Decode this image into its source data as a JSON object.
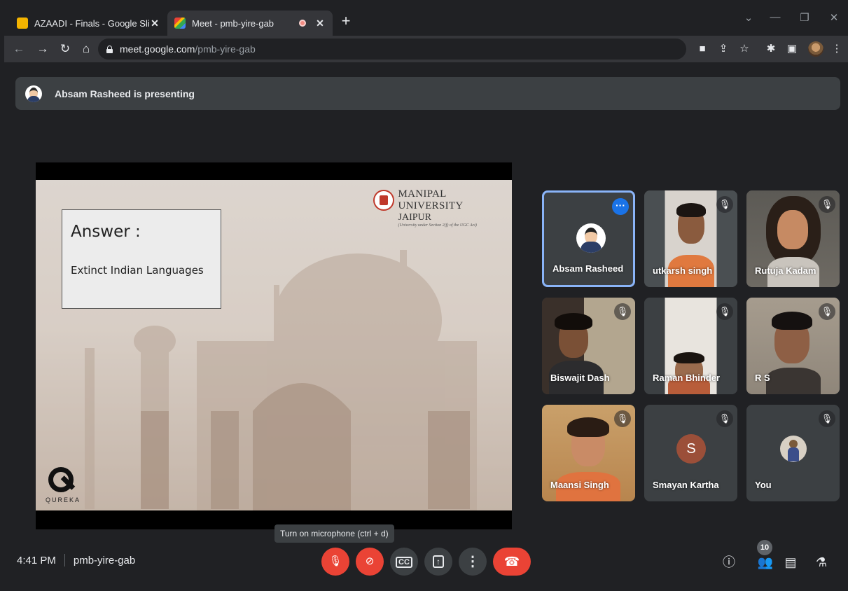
{
  "browser": {
    "tabs": [
      {
        "title": "AZAADI - Finals - Google Slides",
        "active": false,
        "favicon_color": "#f4b400"
      },
      {
        "title": "Meet - pmb-yire-gab",
        "active": true,
        "favicon_color": "#00897b"
      }
    ],
    "new_tab_label": "+",
    "url_host": "meet.google.com",
    "url_path": "/pmb-yire-gab"
  },
  "meet": {
    "presenting_text": "Absam Rasheed is presenting",
    "slide": {
      "answer_title": "Answer :",
      "answer_text": "Extinct Indian Languages",
      "university_line1": "MANIPAL UNIVERSITY",
      "university_line2": "JAIPUR",
      "university_line3": "(University under Section 2(f) of the UGC Act)",
      "brand": "QUREKA"
    },
    "participants": [
      {
        "name": "Absam Rasheed",
        "muted": false,
        "speaking": true,
        "type": "avatar"
      },
      {
        "name": "utkarsh singh",
        "muted": true,
        "type": "video"
      },
      {
        "name": "Rutuja Kadam",
        "muted": true,
        "type": "video"
      },
      {
        "name": "Biswajit Dash",
        "muted": true,
        "type": "video"
      },
      {
        "name": "Raman Bhinder",
        "muted": true,
        "type": "video"
      },
      {
        "name": "R S",
        "muted": true,
        "type": "video"
      },
      {
        "name": "Maansi Singh",
        "muted": true,
        "type": "video"
      },
      {
        "name": "Smayan Kartha",
        "muted": true,
        "type": "letter",
        "letter": "S"
      },
      {
        "name": "You",
        "muted": true,
        "type": "photo"
      }
    ],
    "tooltip": "Turn on microphone (ctrl + d)",
    "time": "4:41 PM",
    "meeting_code": "pmb-yire-gab",
    "people_count": "10",
    "colors": {
      "accent": "#8ab4f8",
      "danger": "#ea4335",
      "surface": "#3c4043",
      "background": "#202124"
    }
  }
}
